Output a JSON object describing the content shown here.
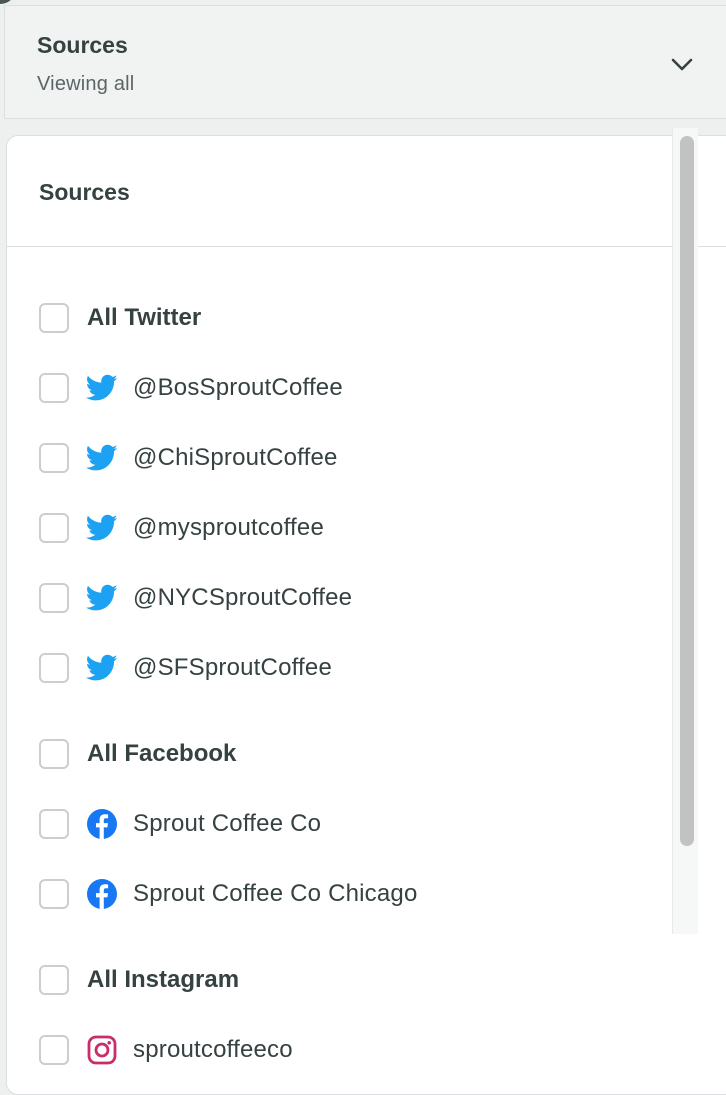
{
  "header": {
    "title": "Sources",
    "subtitle": "Viewing all",
    "toggle_icon": "chevron-down-icon"
  },
  "panel": {
    "title": "Sources"
  },
  "groups": {
    "twitter": {
      "label": "All Twitter",
      "icon": "twitter-icon",
      "color": "#1da1f2",
      "checked": false,
      "items": [
        {
          "label": "@BosSproutCoffee",
          "checked": false
        },
        {
          "label": "@ChiSproutCoffee",
          "checked": false
        },
        {
          "label": "@mysproutcoffee",
          "checked": false
        },
        {
          "label": "@NYCSproutCoffee",
          "checked": false
        },
        {
          "label": "@SFSproutCoffee",
          "checked": false
        }
      ]
    },
    "facebook": {
      "label": "All Facebook",
      "icon": "facebook-icon",
      "color": "#1877f2",
      "checked": false,
      "items": [
        {
          "label": "Sprout Coffee Co",
          "checked": false
        },
        {
          "label": "Sprout Coffee Co Chicago",
          "checked": false
        }
      ]
    },
    "instagram": {
      "label": "All Instagram",
      "icon": "instagram-icon",
      "color": "#c13584",
      "checked": false,
      "items": [
        {
          "label": "sproutcoffeeco",
          "checked": false
        }
      ]
    }
  },
  "colors": {
    "text": "#364141",
    "subtext": "#5b6666",
    "border": "#dcdfdf",
    "header_bg": "#f1f2f2"
  }
}
